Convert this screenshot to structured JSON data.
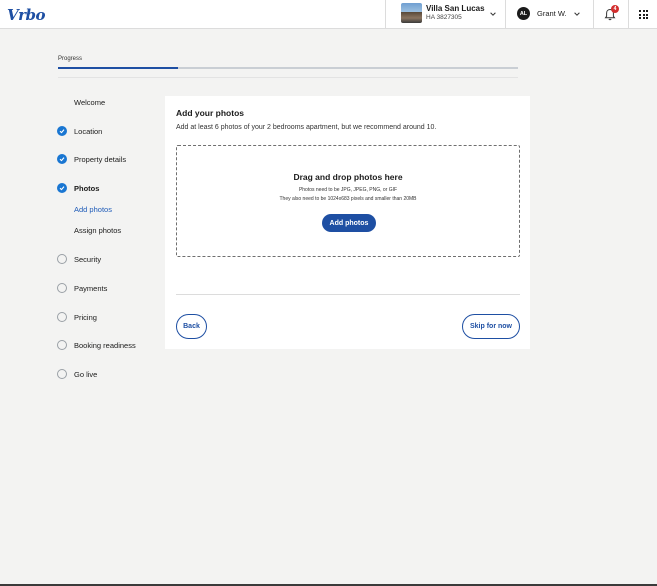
{
  "header": {
    "logo_text": "Vrbo",
    "property_name": "Villa San Lucas",
    "property_id": "HA 3827305",
    "user_initials": "AL",
    "user_name": "Grant W.",
    "notification_count": "4",
    "accent_color": "#1e4fa3"
  },
  "progress": {
    "label": "Progress",
    "fraction": 0.26
  },
  "steps": [
    {
      "label": "Welcome",
      "status": "none"
    },
    {
      "label": "Location",
      "status": "done"
    },
    {
      "label": "Property details",
      "status": "done"
    },
    {
      "label": "Photos",
      "status": "done"
    },
    {
      "label": "Security",
      "status": "todo"
    },
    {
      "label": "Payments",
      "status": "todo"
    },
    {
      "label": "Pricing",
      "status": "todo"
    },
    {
      "label": "Booking readiness",
      "status": "todo"
    },
    {
      "label": "Go live",
      "status": "todo"
    }
  ],
  "substeps": [
    {
      "label": "Add photos",
      "active": true
    },
    {
      "label": "Assign photos",
      "active": false
    }
  ],
  "main": {
    "title": "Add your photos",
    "subtitle": "Add at least 6 photos of your 2 bedrooms apartment, but we recommend around 10.",
    "dropzone": {
      "title": "Drag and drop photos here",
      "requirement_1": "Photos need to be JPG, JPEG, PNG, or GIF",
      "requirement_2": "They also need to be 1024x683 pixels and smaller than 20MB",
      "add_button": "Add photos"
    },
    "back_button": "Back",
    "skip_button": "Skip for now"
  }
}
